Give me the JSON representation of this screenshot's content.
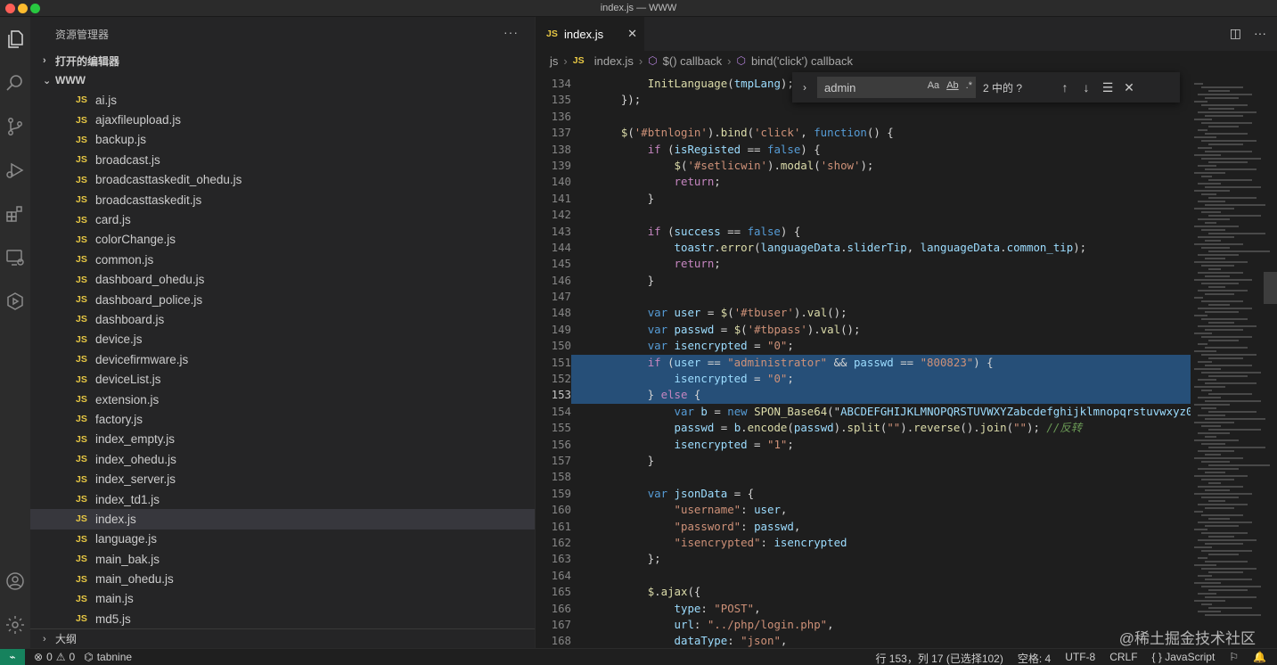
{
  "window": {
    "title": "index.js — WWW"
  },
  "activity_bar": {
    "items": [
      "files-icon",
      "search-icon",
      "source-control-icon",
      "run-debug-icon",
      "extensions-icon",
      "remote-explorer-icon",
      "testing-icon",
      "account-icon",
      "settings-gear-icon"
    ]
  },
  "sidebar": {
    "title": "资源管理器",
    "more": "···",
    "open_editors": "打开的编辑器",
    "folder": "WWW",
    "files": [
      "ai.js",
      "ajaxfileupload.js",
      "backup.js",
      "broadcast.js",
      "broadcasttaskedit_ohedu.js",
      "broadcasttaskedit.js",
      "card.js",
      "colorChange.js",
      "common.js",
      "dashboard_ohedu.js",
      "dashboard_police.js",
      "dashboard.js",
      "device.js",
      "devicefirmware.js",
      "deviceList.js",
      "extension.js",
      "factory.js",
      "index_empty.js",
      "index_ohedu.js",
      "index_server.js",
      "index_td1.js",
      "index.js",
      "language.js",
      "main_bak.js",
      "main_ohedu.js",
      "main.js",
      "md5.js"
    ],
    "active_file": "index.js",
    "outline": "大纲",
    "js_badge": "JS"
  },
  "editor": {
    "tab_label": "index.js",
    "tab_close": "✕",
    "breadcrumb": [
      "js",
      "index.js",
      "$() callback",
      "bind('click') callback"
    ],
    "find": {
      "query": "admin",
      "opt_case": "Aa",
      "opt_word": "Ab",
      "opt_regex": ".*",
      "result": "2 中的 ?",
      "prev": "↑",
      "next": "↓",
      "selection": "☰",
      "close": "✕"
    },
    "lines": [
      {
        "n": "134",
        "code": "        InitLanguage(tmpLang);"
      },
      {
        "n": "135",
        "code": "    });"
      },
      {
        "n": "136",
        "code": ""
      },
      {
        "n": "137",
        "code": "    $('#btnlogin').bind('click', function() {"
      },
      {
        "n": "138",
        "code": "        if (isRegisted == false) {"
      },
      {
        "n": "139",
        "code": "            $('#setlicwin').modal('show');"
      },
      {
        "n": "140",
        "code": "            return;"
      },
      {
        "n": "141",
        "code": "        }"
      },
      {
        "n": "142",
        "code": ""
      },
      {
        "n": "143",
        "code": "        if (success == false) {"
      },
      {
        "n": "144",
        "code": "            toastr.error(languageData.sliderTip, languageData.common_tip);"
      },
      {
        "n": "145",
        "code": "            return;"
      },
      {
        "n": "146",
        "code": "        }"
      },
      {
        "n": "147",
        "code": ""
      },
      {
        "n": "148",
        "code": "        var user = $('#tbuser').val();"
      },
      {
        "n": "149",
        "code": "        var passwd = $('#tbpass').val();"
      },
      {
        "n": "150",
        "code": "        var isencrypted = \"0\";"
      },
      {
        "n": "151",
        "code": "        if (user == \"administrator\" && passwd == \"800823\") {"
      },
      {
        "n": "152",
        "code": "            isencrypted = \"0\";"
      },
      {
        "n": "153",
        "code": "        } else {"
      },
      {
        "n": "154",
        "code": "            var b = new SPON_Base64(\"ABCDEFGHIJKLMNOPQRSTUVWXYZabcdefghijklmnopqrstuvwxyz0"
      },
      {
        "n": "155",
        "code": "            passwd = b.encode(passwd).split(\"\").reverse().join(\"\"); //反转"
      },
      {
        "n": "156",
        "code": "            isencrypted = \"1\";"
      },
      {
        "n": "157",
        "code": "        }"
      },
      {
        "n": "158",
        "code": ""
      },
      {
        "n": "159",
        "code": "        var jsonData = {"
      },
      {
        "n": "160",
        "code": "            \"username\": user,"
      },
      {
        "n": "161",
        "code": "            \"password\": passwd,"
      },
      {
        "n": "162",
        "code": "            \"isencrypted\": isencrypted"
      },
      {
        "n": "163",
        "code": "        };"
      },
      {
        "n": "164",
        "code": ""
      },
      {
        "n": "165",
        "code": "        $.ajax({"
      },
      {
        "n": "166",
        "code": "            type: \"POST\","
      },
      {
        "n": "167",
        "code": "            url: \"../php/login.php\","
      },
      {
        "n": "168",
        "code": "            dataType: \"json\","
      }
    ],
    "current_line": "153"
  },
  "statusbar": {
    "errors": "0",
    "warnings": "0",
    "tabnine": "tabnine",
    "position": "行 153，列 17 (已选择102)",
    "spaces": "空格: 4",
    "encoding": "UTF-8",
    "eol": "CRLF",
    "language": "JavaScript",
    "braces": "{ }"
  },
  "watermark": "@稀土掘金技术社区"
}
